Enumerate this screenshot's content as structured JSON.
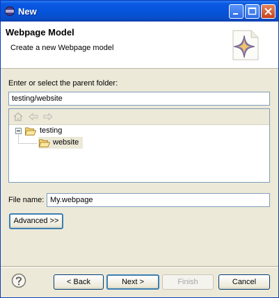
{
  "window": {
    "title": "New"
  },
  "header": {
    "title": "Webpage Model",
    "description": "Create a new Webpage model"
  },
  "folder": {
    "label": "Enter or select the parent folder:",
    "value": "testing/website"
  },
  "tree": {
    "items": [
      {
        "label": "testing",
        "expanded": true
      },
      {
        "label": "website",
        "selected": true
      }
    ]
  },
  "filename": {
    "label": "File name:",
    "value": "My.webpage"
  },
  "advanced_button": "Advanced >>",
  "footer": {
    "back": "< Back",
    "next": "Next >",
    "finish": "Finish",
    "cancel": "Cancel"
  },
  "colors": {
    "titlebar": "#0553d8",
    "dialog_bg": "#ece9d8",
    "selection": "#ece9d8"
  }
}
